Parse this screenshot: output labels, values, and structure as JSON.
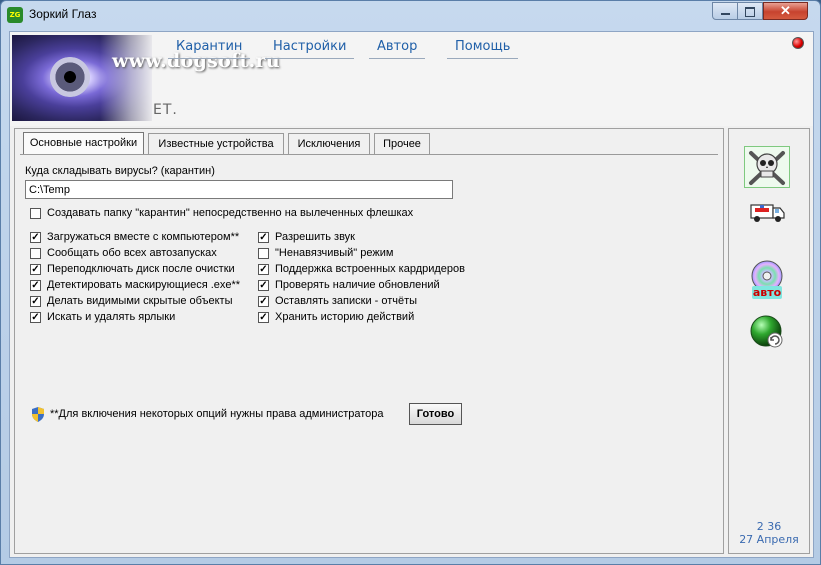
{
  "window": {
    "title": "Зоркий Глаз",
    "app_icon_text": "ZG",
    "close_label": "✕"
  },
  "header": {
    "watermark": "www.dogsoft.ru",
    "subtext": "ЕТ.",
    "nav": [
      "Карантин",
      "Настройки",
      "Автор",
      "Помощь"
    ]
  },
  "tabs": [
    "Основные настройки",
    "Известные устройства",
    "Исключения",
    "Прочее"
  ],
  "settings": {
    "quarantine_label": "Куда складывать вирусы? (карантин)",
    "quarantine_path": "C:\\Temp",
    "create_folder": {
      "label": "Создавать папку \"карантин\" непосредственно на вылеченных флешках",
      "checked": false
    },
    "left_options": [
      {
        "label": "Загружаться вместе с компьютером**",
        "checked": true
      },
      {
        "label": "Сообщать обо всех автозапусках",
        "checked": false
      },
      {
        "label": "Переподключать диск после очистки",
        "checked": true
      },
      {
        "label": "Детектировать маскирующиеся .exe**",
        "checked": true
      },
      {
        "label": "Делать видимыми скрытые объекты",
        "checked": true
      },
      {
        "label": "Искать и удалять ярлыки",
        "checked": true
      }
    ],
    "right_options": [
      {
        "label": "Разрешить звук",
        "checked": true
      },
      {
        "label": "\"Ненавязчивый\" режим",
        "checked": false
      },
      {
        "label": "Поддержка встроенных кардридеров",
        "checked": true
      },
      {
        "label": "Проверять наличие обновлений",
        "checked": true
      },
      {
        "label": "Оставлять записки - отчёты",
        "checked": true
      },
      {
        "label": "Хранить историю действий",
        "checked": true
      }
    ],
    "admin_note": "**Для включения некоторых опций нужны права администратора",
    "done_label": "Готово"
  },
  "side": {
    "items": [
      "skull-crossbones-icon",
      "ambulance-icon",
      "cd-autorun-icon",
      "globe-update-icon"
    ],
    "auto_label": "авто",
    "clock_time": "2 36",
    "clock_date": "27 Апреля"
  },
  "colors": {
    "link": "#1f5fa8",
    "clock": "#3a6ab0",
    "status_dot": "#dd0000",
    "selected_side": "#7fc97f"
  }
}
